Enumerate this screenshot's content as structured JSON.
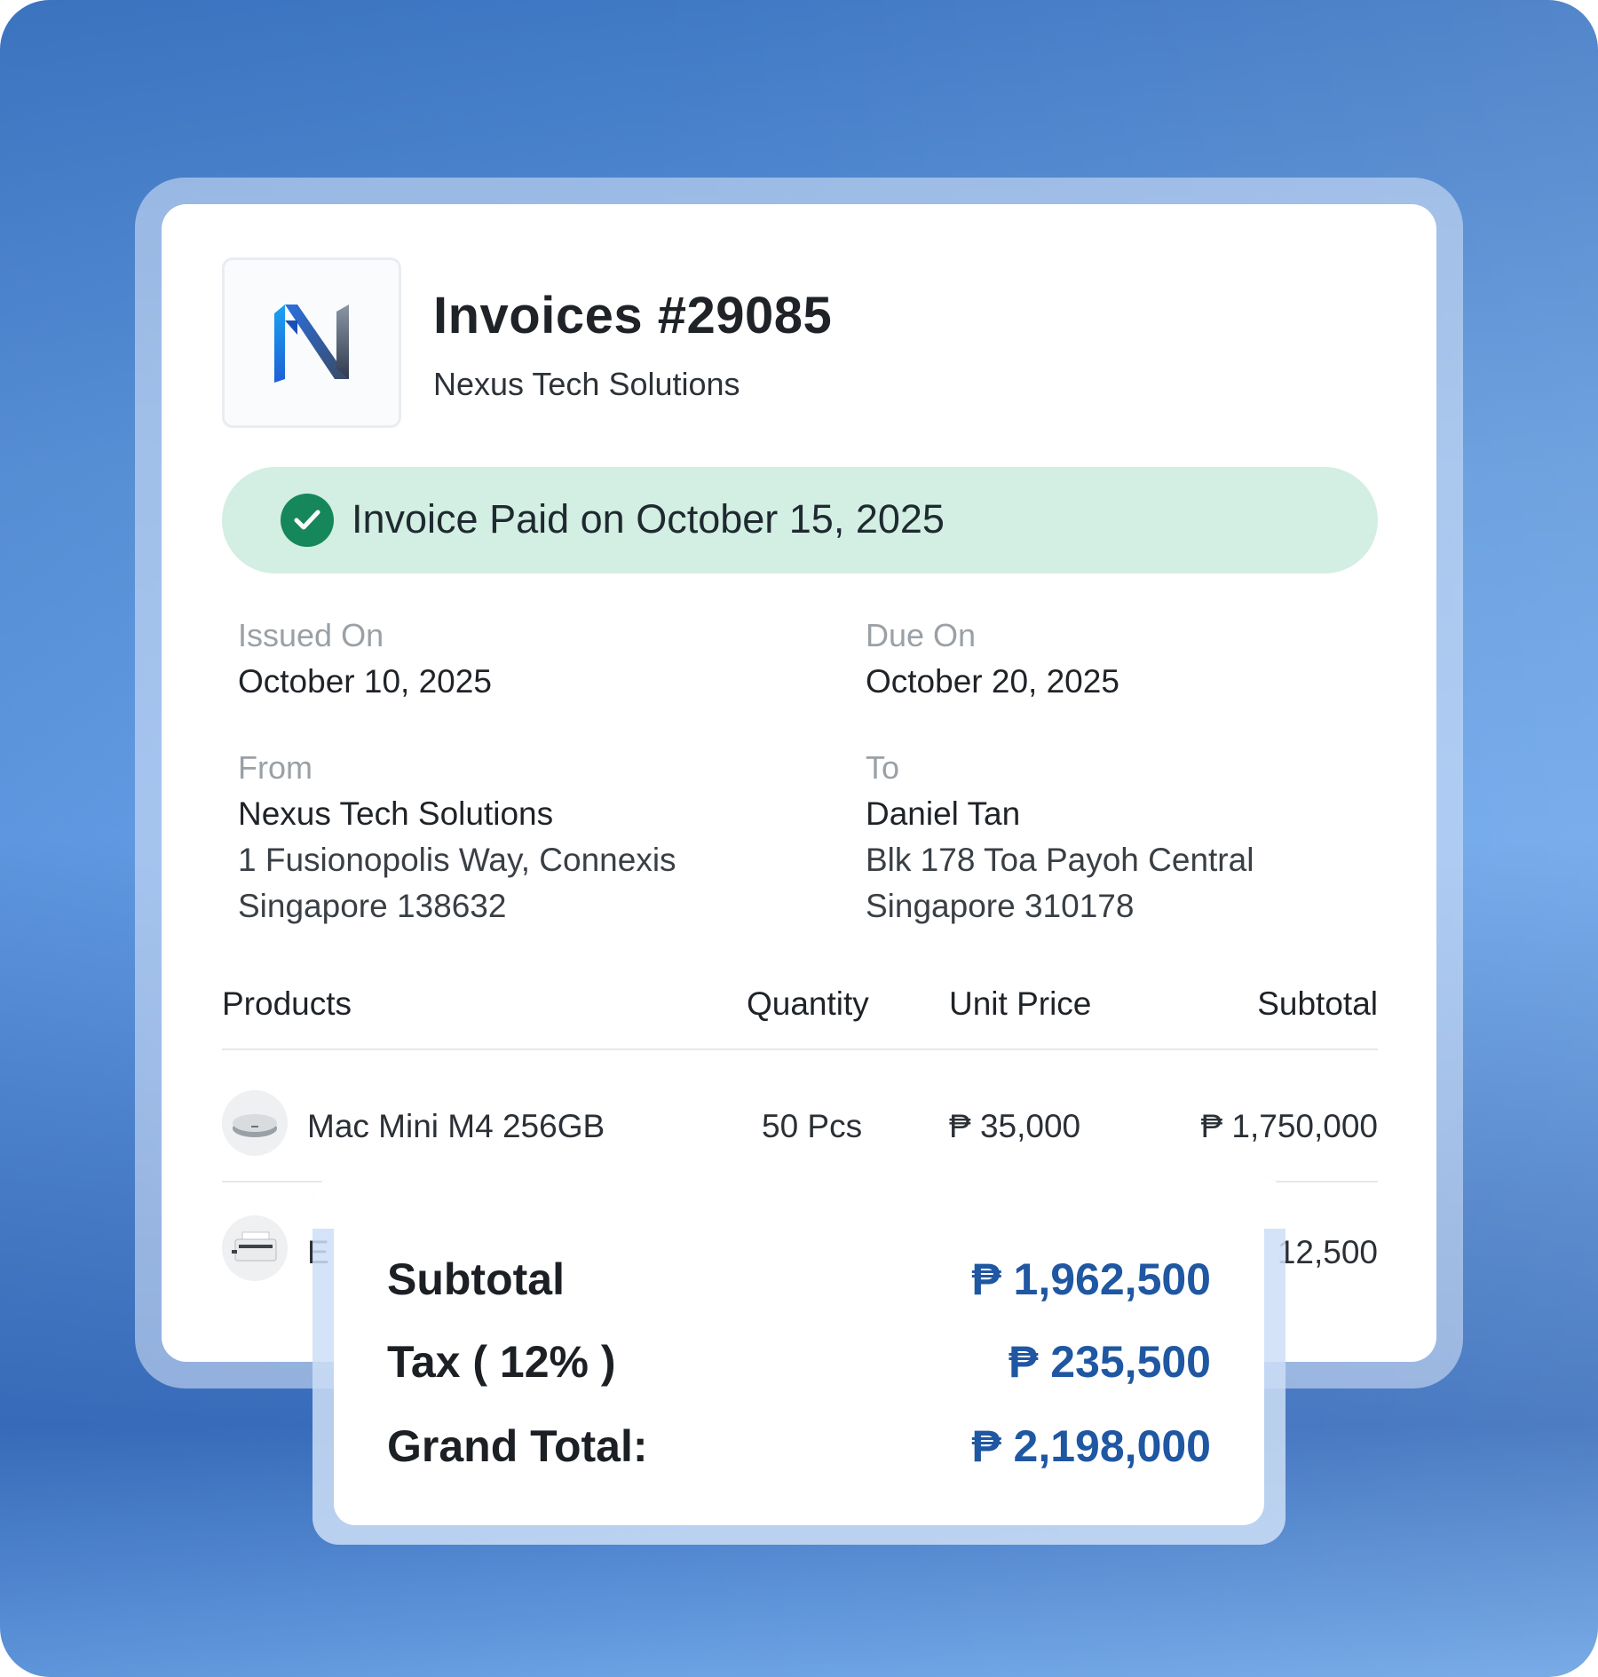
{
  "invoice": {
    "title": "Invoices #29085",
    "company": "Nexus Tech Solutions",
    "paid_status": "Invoice Paid on October 15, 2025",
    "issued": {
      "label": "Issued On",
      "date": "October 10, 2025"
    },
    "due": {
      "label": "Due On",
      "date": "October 20, 2025"
    },
    "from": {
      "label": "From",
      "name": "Nexus Tech Solutions",
      "address_line1": "1 Fusionopolis Way, Connexis",
      "address_line2": "Singapore 138632"
    },
    "to": {
      "label": "To",
      "name": "Daniel Tan",
      "address_line1": "Blk 178 Toa Payoh Central",
      "address_line2": "Singapore 310178"
    }
  },
  "table": {
    "headers": [
      "Products",
      "Quantity",
      "Unit Price",
      "Subtotal"
    ],
    "rows": [
      {
        "icon": "mac-mini-icon",
        "product": "Mac Mini M4 256GB",
        "quantity": "50 Pcs",
        "unit_price": "₱ 35,000",
        "subtotal": "₱ 1,750,000"
      },
      {
        "icon": "printer-icon",
        "product": "E",
        "subtotal": "12,500"
      }
    ]
  },
  "totals": {
    "subtotal_label": "Subtotal",
    "subtotal_value": "₱ 1,962,500",
    "tax_label": "Tax ( 12% )",
    "tax_value": "₱ 235,500",
    "grand_label": "Grand Total:",
    "grand_value": "₱ 2,198,000"
  },
  "colors": {
    "paid_bar": "#d3eee2",
    "check": "#16875a",
    "total_values": "#1f57a2",
    "background": "#5f98dc"
  }
}
